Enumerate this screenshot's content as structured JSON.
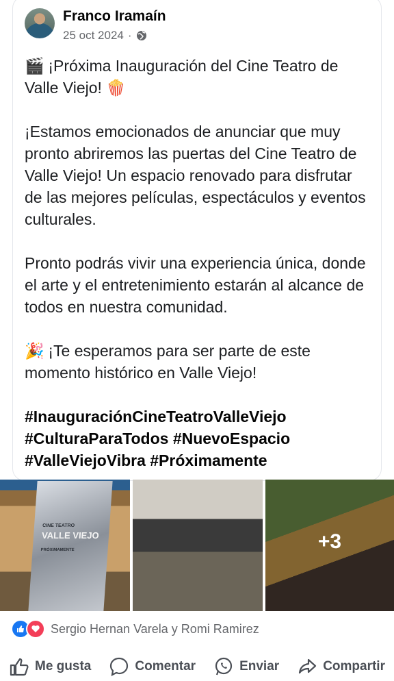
{
  "post": {
    "author": "Franco Iramaín",
    "date": "25 oct 2024",
    "privacy_icon": "globe-icon",
    "title_emoji": "🎬",
    "title": "¡Próxima Inauguración del Cine Teatro de Valle Viejo!",
    "title_end_emoji": "🍿",
    "paragraph1": "¡Estamos emocionados de anunciar que muy pronto abriremos las puertas del Cine Teatro de Valle Viejo! Un espacio renovado para disfrutar de las mejores películas, espectáculos y eventos culturales.",
    "paragraph2": "Pronto podrás vivir una experiencia única, donde el arte y el entretenimiento estarán al alcance de todos en nuestra comunidad.",
    "invite_emoji": "🎉",
    "paragraph3": "¡Te esperamos para ser parte de este momento histórico en Valle Viejo!",
    "hashtags_line1": "#InauguraciónCineTeatroValleViejo",
    "hashtags_line2": "#CulturaParaTodos #NuevoEspacio",
    "hashtags_line3": "#ValleViejoVibra #Próximamente"
  },
  "photos": {
    "sign_line1": "CINE TEATRO",
    "sign_line2": "VALLE VIEJO",
    "sign_line3": "PRÓXIMAMENTE",
    "more_count": "+3"
  },
  "reactions": {
    "names": "Sergio Hernan Varela y Romi Ramirez"
  },
  "actions": {
    "like": "Me gusta",
    "comment": "Comentar",
    "send": "Enviar",
    "share": "Compartir"
  }
}
